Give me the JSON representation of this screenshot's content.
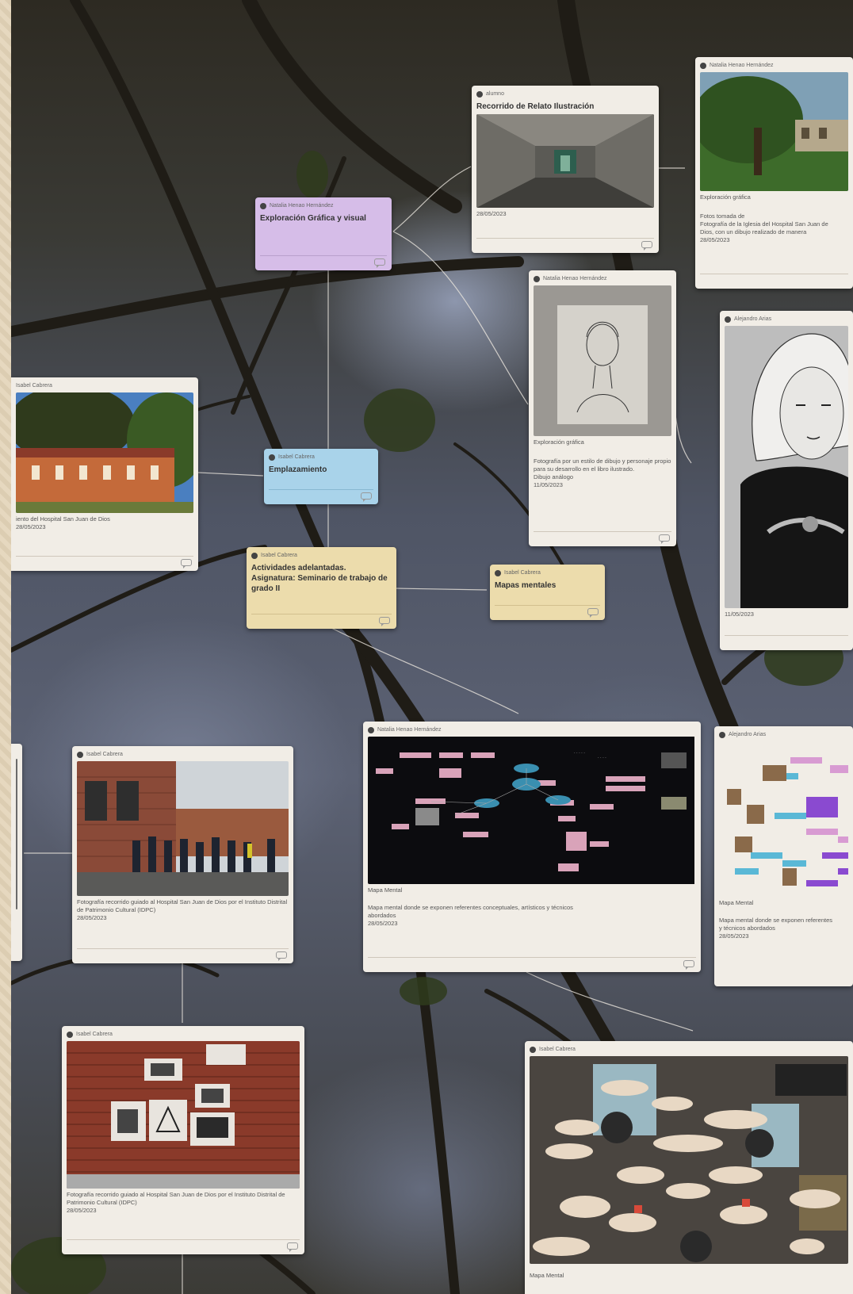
{
  "cards": {
    "relato": {
      "author": "alumno",
      "title": "Recorrido de Relato Ilustración",
      "date": "28/05/2023"
    },
    "top_right": {
      "author": "Natalia Henao Hernández",
      "label": "Exploración gráfica",
      "text1": "Fotos tomada de",
      "text2": "Fotografía de la Iglesia del Hospital San Juan de",
      "text3": "Dios, con un dibujo realizado de manera",
      "date": "28/05/2023"
    },
    "exploracion": {
      "author": "Natalia Henao Hernández",
      "title": "Exploración Gráfica y visual"
    },
    "dibujo": {
      "author": "Natalia Henao Hernández",
      "label": "Exploración gráfica",
      "text": "Fotografía por un estilo de dibujo y personaje propio para su desarrollo en el libro ilustrado.",
      "text2": "Dibujo análogo",
      "date": "11/05/2023"
    },
    "retrato": {
      "author": "Alejandro Arias",
      "date": "11/05/2023"
    },
    "hospital": {
      "author": "Isabel Cabrera",
      "text": "iento del Hospital San Juan de Dios",
      "date": "28/05/2023"
    },
    "emplazamiento": {
      "author": "Isabel Cabrera",
      "title": "Emplazamiento"
    },
    "actividades": {
      "author": "Isabel Cabrera",
      "title": "Actividades adelantadas. Asignatura: Seminario de trabajo de grado II"
    },
    "mapas": {
      "author": "Isabel Cabrera",
      "title": "Mapas mentales"
    },
    "recorrido": {
      "author": "Isabel Cabrera",
      "text": "Fotografía recorrido guiado al Hospital San Juan de Dios por el Instituto Distrital de Patrimonio Cultural (IDPC)",
      "date": "28/05/2023"
    },
    "mapa_mental": {
      "author": "Natalia Henao Hernández",
      "label": "Mapa Mental",
      "text": "Mapa mental donde se exponen referentes conceptuales, artísticos y técnicos",
      "text2": "abordados",
      "date": "28/05/2023"
    },
    "mapa_right": {
      "author": "Alejandro Arias",
      "label": "Mapa Mental",
      "text": "Mapa mental donde se exponen referentes",
      "text2": "y técnicos abordados",
      "date": "28/05/2023"
    },
    "muro": {
      "author": "Isabel Cabrera",
      "text": "Fotografía recorrido guiado al Hospital San Juan de Dios por el Instituto Distrital de Patrimonio Cultural (IDPC)",
      "date": "28/05/2023"
    },
    "mapa_bottom": {
      "author": "Isabel Cabrera",
      "caption": "Mapa Mental"
    }
  }
}
